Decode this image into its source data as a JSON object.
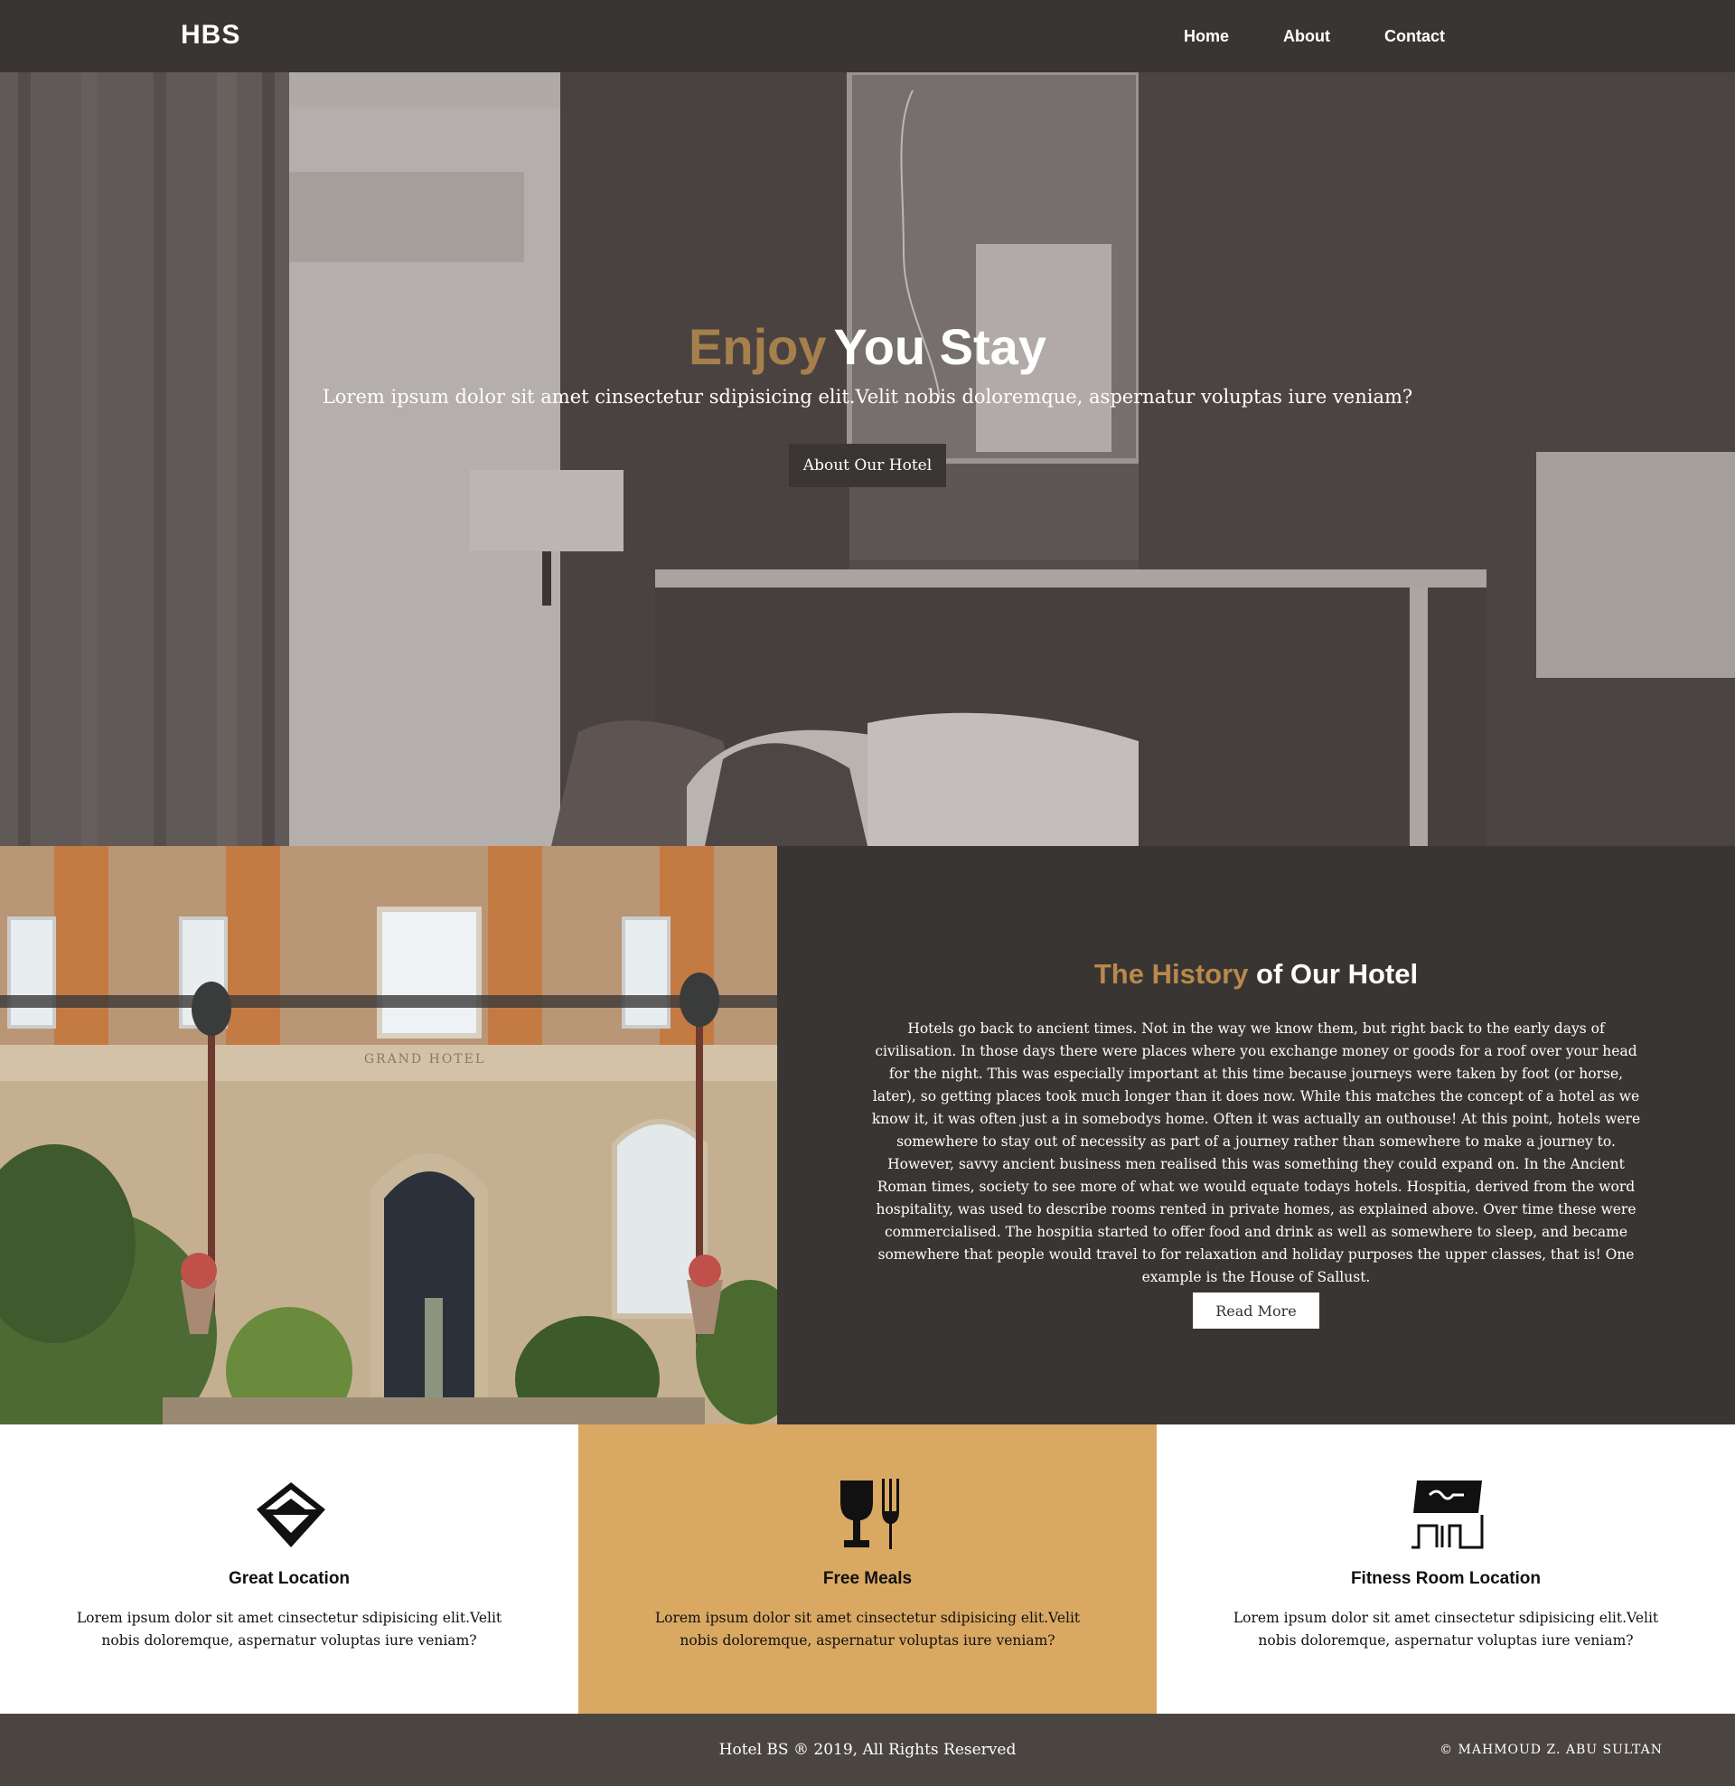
{
  "navbar": {
    "brand": "HBS",
    "links": [
      "Home",
      "About",
      "Contact"
    ]
  },
  "hero": {
    "title_accent": "Enjoy",
    "title_rest": "You Stay",
    "subtitle": "Lorem ipsum dolor sit amet cinsectetur sdipisicing elit.Velit nobis doloremque, aspernatur voluptas iure veniam?",
    "button_label": "About Our Hotel"
  },
  "history": {
    "title_accent": "The History",
    "title_rest": "of Our Hotel",
    "photo_sign": "GRAND HOTEL",
    "text": "Hotels go back to ancient times. Not in the way we know them, but right back to the early days of civilisation. In those days there were places where you exchange money or goods for a roof over your head for the night. This was especially important at this time because journeys were taken by foot (or horse, later), so getting places took much longer than it does now. While this matches the concept of a hotel as we know it, it was often just a in somebodys home. Often it was actually an outhouse! At this point, hotels were somewhere to stay out of necessity as part of a journey rather than somewhere to make a journey to. However, savvy ancient business men realised this was something they could expand on. In the Ancient Roman times, society to see more of what we would equate todays hotels. Hospitia, derived from the word hospitality, was used to describe rooms rented in private homes, as explained above. Over time these were commercialised. The hospitia started to offer food and drink as well as somewhere to sleep, and became somewhere that people would travel to for relaxation and holiday purposes the upper classes, that is! One example is the House of Sallust.",
    "button_label": "Read More"
  },
  "features": [
    {
      "icon": "location-icon",
      "title": "Great Location",
      "text": "Lorem ipsum dolor sit amet cinsectetur sdipisicing elit.Velit nobis doloremque, aspernatur voluptas iure veniam?"
    },
    {
      "icon": "meals-icon",
      "title": "Free Meals",
      "text": "Lorem ipsum dolor sit amet cinsectetur sdipisicing elit.Velit nobis doloremque, aspernatur voluptas iure veniam?"
    },
    {
      "icon": "fitness-icon",
      "title": "Fitness Room Location",
      "text": "Lorem ipsum dolor sit amet cinsectetur sdipisicing elit.Velit nobis doloremque, aspernatur voluptas iure veniam?"
    }
  ],
  "footer": {
    "copyright": "Hotel BS ® 2019, All Rights Reserved",
    "author": "© MAHMOUD Z. ABU SULTAN"
  },
  "colors": {
    "dark": "#383532",
    "gold": "#d9a862",
    "accent_text": "#b8894c"
  }
}
